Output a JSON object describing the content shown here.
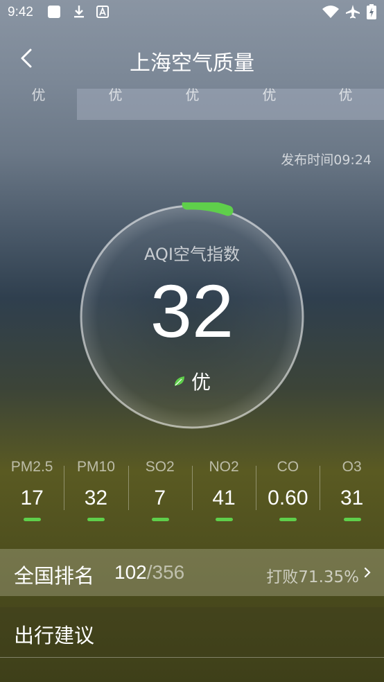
{
  "status_bar": {
    "time": "9:42",
    "icons": [
      "square-notification-icon",
      "download-icon",
      "font-icon",
      "wifi-icon",
      "airplane-icon",
      "battery-charging-icon"
    ]
  },
  "header": {
    "back_icon": "chevron-left-icon",
    "title": "上海空气质量"
  },
  "tabs": [
    {
      "label": "优"
    },
    {
      "label": "优"
    },
    {
      "label": "优"
    },
    {
      "label": "优"
    },
    {
      "label": "优"
    }
  ],
  "publish_time": "发布时间09:24",
  "aqi": {
    "label": "AQI空气指数",
    "value": "32",
    "level": "优",
    "level_icon": "leaf-icon",
    "accent_color": "#5fcf4b"
  },
  "pollutants": [
    {
      "name": "PM2.5",
      "value": "17"
    },
    {
      "name": "PM10",
      "value": "32"
    },
    {
      "name": "SO2",
      "value": "7"
    },
    {
      "name": "NO2",
      "value": "41"
    },
    {
      "name": "CO",
      "value": "0.60"
    },
    {
      "name": "O3",
      "value": "31"
    }
  ],
  "ranking": {
    "title": "全国排名",
    "rank": "102",
    "total": "/356",
    "beat": "打败71.35%"
  },
  "advice": {
    "title": "出行建议"
  }
}
